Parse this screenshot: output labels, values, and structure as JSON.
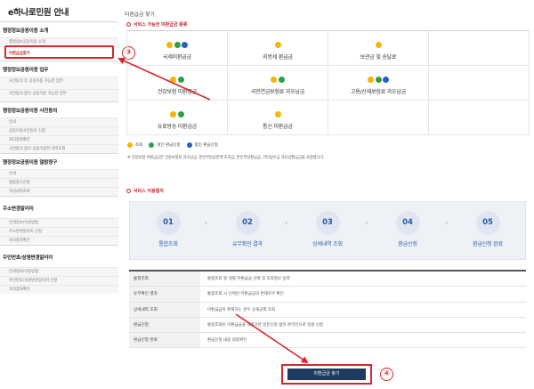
{
  "sidebar": {
    "title": "e하나로민원 안내",
    "groups": [
      {
        "head": "행정정보공동이용 소개",
        "items": [
          "행정정보공동이용 소개",
          "미환급금찾기"
        ]
      },
      {
        "head": "행정정보공동이용 업무",
        "items": [
          "사전동의 후 공동이용 가능한 업무",
          "사전동의 없이 공동이용 가능한 업무"
        ]
      },
      {
        "head": "행정정보공동이용 사전동의",
        "items": [
          "안내",
          "공동이용사전동의 신청",
          "처리결과확인",
          "사전동의 없이 공동이용한 내역조회"
        ]
      },
      {
        "head": "행정정보공동이용 열람청구",
        "items": [
          "안내",
          "열람청구신청",
          "처리내역조회"
        ]
      },
      {
        "head": "주소변경알리미",
        "items": [
          "안내정보/이용방법",
          "주소변경알리미 신청",
          "처리결과확인"
        ]
      },
      {
        "head": "주민번호/성명변경알리미",
        "items": [
          "안내정보/이용방법",
          "주민번호/성명변경알리미 신청",
          "처리결과확인"
        ]
      }
    ]
  },
  "markers": {
    "m3": "③",
    "m4": "④"
  },
  "main": {
    "page_title": "미환급금 찾기",
    "services_section_title": "서비스 가능한 미환급금 종류",
    "services": [
      {
        "label": "국세미환급금",
        "dots": [
          "#f2b705",
          "#2e9e48",
          "#1f5fc4"
        ]
      },
      {
        "label": "지방세 환급금",
        "dots": [
          "#f2b705"
        ]
      },
      {
        "label": "보관금 및 송달료",
        "dots": [
          "#f2b705"
        ]
      },
      {
        "label": "건강보험 미환급금",
        "dots": [
          "#f2b705",
          "#2e9e48"
        ]
      },
      {
        "label": "국민연금보험료 과오납금",
        "dots": [
          "#f2b705",
          "#2e9e48"
        ]
      },
      {
        "label": "고용/산재보험료 과오납금",
        "dots": [
          "#f2b705",
          "#2e9e48",
          "#1f5fc4"
        ]
      },
      {
        "label": "유료방송 미환급금",
        "dots": [
          "#f2b705",
          "#2e9e48"
        ]
      },
      {
        "label": "통신 미환급금",
        "dots": [
          "#f2b705"
        ]
      }
    ],
    "legend": [
      {
        "label": "조회",
        "color": "#f2b705"
      },
      {
        "label": "개인 환급신청",
        "color": "#2e9e48"
      },
      {
        "label": "법인 환급신청",
        "color": "#1f5fc4"
      }
    ],
    "note": "※ 건강보험 미환급금은 건강보험료 과오납금, 본인부담상한액 초과금, 본인부담환급금, 기타징수금 과오납환급금을 포함합니다.",
    "procedure_section_title": "서비스 이용절차",
    "steps": [
      {
        "num": "01",
        "label": "통합조회"
      },
      {
        "num": "02",
        "label": "유무확인 결과"
      },
      {
        "num": "03",
        "label": "상세내역 조회"
      },
      {
        "num": "04",
        "label": "환급신청"
      },
      {
        "num": "05",
        "label": "환급신청 완료"
      }
    ],
    "table": [
      {
        "key": "통합조회",
        "val": "통합조회 할 개별 미환급금 선택 및 조회정보 입력"
      },
      {
        "key": "유무확인 결과",
        "val": "통합조회 시 선택된 미환급금의 존재유무 확인"
      },
      {
        "key": "상세내역 조회",
        "val": "미환급금이 존재하는 경우 상세금액 조회"
      },
      {
        "key": "환급신청",
        "val": "통합조회된 미환급금을 개별기관 방문신청 없이 온라인으로 일괄 신청"
      },
      {
        "key": "환급신청 완료",
        "val": "환급신청 내용 최종확인"
      }
    ],
    "cta_label": "미환급금 찾기"
  },
  "colors": {
    "accent_red": "#d9262c",
    "navy": "#1f3a5f",
    "step_blue": "#2a5aa6"
  }
}
